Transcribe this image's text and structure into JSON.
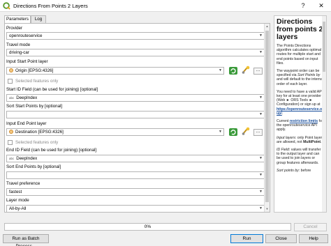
{
  "window": {
    "title": "Directions From Points 2 Layers",
    "help_glyph": "?",
    "close_glyph": "✕"
  },
  "tabs": [
    {
      "label": "Parameters",
      "active": true
    },
    {
      "label": "Log",
      "active": false
    }
  ],
  "form": {
    "provider_label": "Provider",
    "provider_value": "openrouteservice",
    "travel_mode_label": "Travel mode",
    "travel_mode_value": "driving-car",
    "start_layer_label": "Input Start Point layer",
    "start_layer_value": "Origin [EPSG:4326]",
    "start_selected_only": "Selected features only",
    "start_id_label": "Start ID Field (can be used for joining) [optional]",
    "start_id_value": "DeepIndex",
    "sort_start_label": "Sort Start Points by [optional]",
    "sort_start_value": "",
    "end_layer_label": "Input End Point layer",
    "end_layer_value": "Destination [EPSG:4326]",
    "end_selected_only": "Selected features only",
    "end_id_label": "End ID Field (can be used for joining) [optional]",
    "end_id_value": "DeepIndex",
    "sort_end_label": "Sort End Points by [optional]",
    "sort_end_value": "",
    "travel_pref_label": "Travel preference",
    "travel_pref_value": "fastest",
    "layer_mode_label": "Layer mode",
    "layer_mode_value": "All-by-All",
    "abc_tag": "abc",
    "dots": "…"
  },
  "help": {
    "title": "Directions from points 2 layers",
    "p1": "The Points Directions algorithm calculates optimal routes for multiple start and end points based on input files.",
    "p2_a": "The waypoint order can be specified via ",
    "p2_em": "Sort Points by",
    "p2_b": " and will default to the internal order of each layer.",
    "p3_a": "You need to have a valid API key for at least one provider (Web ► ORS Tools ► Configuration) or sign up at ",
    "p3_link": "https://openrouteservice.org/sign-up/",
    "p3_b": ".",
    "p4_a": "Current ",
    "p4_link": "restriction limits",
    "p4_b": " for the openrouteservice API apply.",
    "p5_em": "Input layers",
    "p5_a": ": only Point layers are allowed, not ",
    "p5_b": "MultiPoint",
    "p5_c": ".",
    "p6_em": "ID Field",
    "p6_a": ": values will transfer to the output layer and can be used to join layers or group features afterwards.",
    "p7_em": "Sort points by",
    "p7_a": ": before"
  },
  "progress": {
    "text": "0%",
    "value": 0
  },
  "buttons": {
    "cancel": "Cancel",
    "batch": "Run as Batch Process...",
    "run": "Run",
    "close": "Close",
    "help": "Help"
  },
  "colors": {
    "accent": "#0078d7",
    "link": "#1a4f9c",
    "layer_icon": "#f3c882",
    "refresh_icon": "#3a9a3a"
  },
  "icons": [
    "qgis-logo-icon",
    "dropdown-arrow-icon",
    "point-layer-icon",
    "iterate-icon",
    "digitize-tool-icon",
    "string-field-icon"
  ]
}
